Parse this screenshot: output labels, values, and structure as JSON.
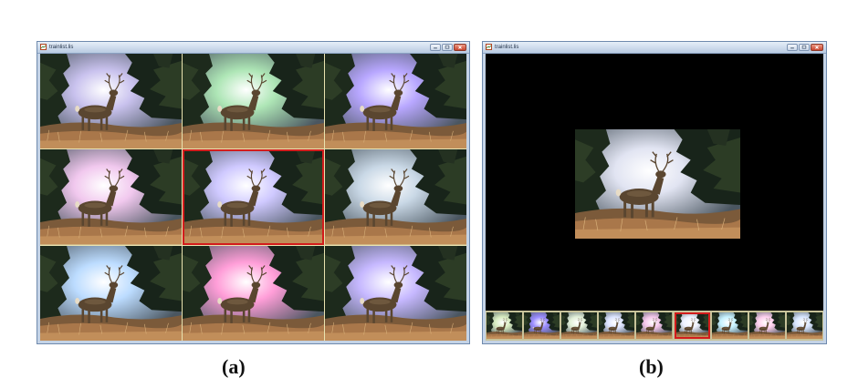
{
  "windows": [
    {
      "title": "trainlist.lis",
      "view": "grid",
      "cells": [
        {
          "tint": "#c9c2ee",
          "selected": false
        },
        {
          "tint": "#aee6b6",
          "selected": false
        },
        {
          "tint": "#b8a7ff",
          "selected": false
        },
        {
          "tint": "#f1c8ee",
          "selected": false
        },
        {
          "tint": "#cfc9ff",
          "selected": true
        },
        {
          "tint": "#c9d8e6",
          "selected": false
        },
        {
          "tint": "#bcdcff",
          "selected": false
        },
        {
          "tint": "#ff9ed8",
          "selected": false
        },
        {
          "tint": "#c6b8ff",
          "selected": false
        }
      ]
    },
    {
      "title": "trainlist.lis",
      "view": "single",
      "main_tint": "#e1e4f2",
      "thumbnails": [
        {
          "tint": "#d8ecc0",
          "selected": false
        },
        {
          "tint": "#9a8cff",
          "selected": false
        },
        {
          "tint": "#e2f0d8",
          "selected": false
        },
        {
          "tint": "#dde4ff",
          "selected": false
        },
        {
          "tint": "#f4c6ea",
          "selected": false
        },
        {
          "tint": "#eef2ff",
          "selected": true
        },
        {
          "tint": "#c6f2ff",
          "selected": false
        },
        {
          "tint": "#ffd0ee",
          "selected": false
        },
        {
          "tint": "#d8e6ff",
          "selected": false
        }
      ]
    }
  ],
  "captions": {
    "a": "(a)",
    "b": "(b)"
  },
  "colors": {
    "selection": "#d31c1c",
    "window_frame": "#c4d3e6",
    "grid_separator": "#e9e3b0"
  },
  "icons": {
    "app": "image-file-icon",
    "minimize": "minimize-icon",
    "maximize": "maximize-icon",
    "close": "close-icon"
  }
}
